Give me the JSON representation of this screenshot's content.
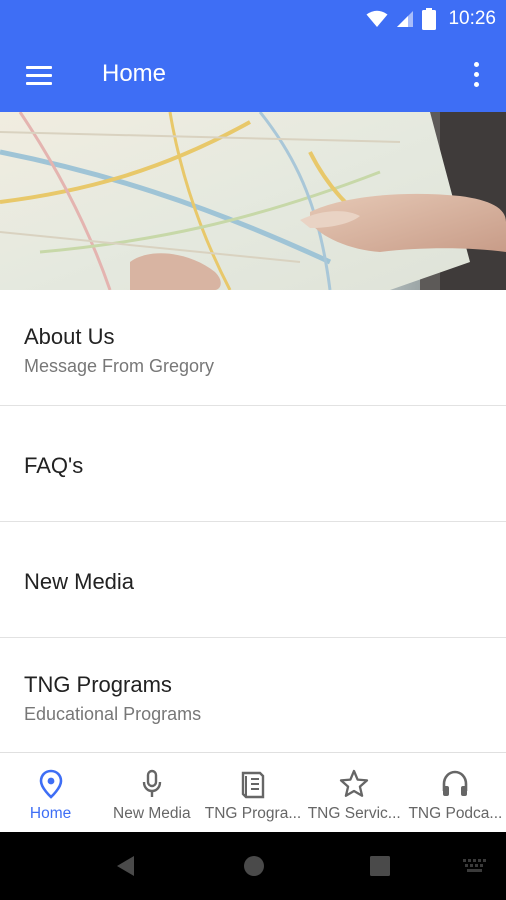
{
  "status_bar": {
    "time": "10:26"
  },
  "app_bar": {
    "title": "Home"
  },
  "list": [
    {
      "title": "About Us",
      "subtitle": "Message From Gregory"
    },
    {
      "title": "FAQ's",
      "subtitle": ""
    },
    {
      "title": "New Media",
      "subtitle": ""
    },
    {
      "title": "TNG Programs",
      "subtitle": "Educational Programs"
    }
  ],
  "bottom_nav": [
    {
      "label": "Home",
      "icon": "location-pin-icon",
      "active": true
    },
    {
      "label": "New Media",
      "icon": "microphone-icon",
      "active": false
    },
    {
      "label": "TNG Progra...",
      "icon": "book-icon",
      "active": false
    },
    {
      "label": "TNG Servic...",
      "icon": "star-icon",
      "active": false
    },
    {
      "label": "TNG Podca...",
      "icon": "headphones-icon",
      "active": false
    }
  ],
  "colors": {
    "primary": "#3e6ef5",
    "text": "#222222",
    "subtext": "#777777",
    "inactive_nav": "#666666"
  }
}
